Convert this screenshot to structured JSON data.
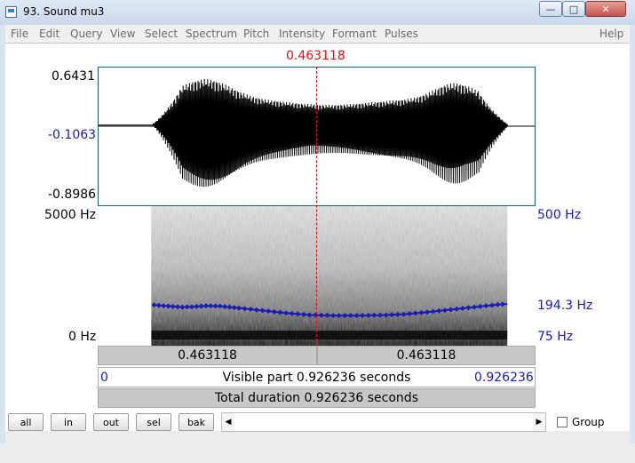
{
  "window": {
    "title": "93. Sound mu3",
    "minimize_glyph": "—",
    "maximize_glyph": "□",
    "close_glyph": "✕",
    "icon": "praat-window-icon"
  },
  "menu": {
    "items": [
      "File",
      "Edit",
      "Query",
      "View",
      "Select",
      "Spectrum",
      "Pitch",
      "Intensity",
      "Formant",
      "Pulses"
    ],
    "help": "Help"
  },
  "cursor": {
    "time_label": "0.463118",
    "time": 0.463118
  },
  "waveform": {
    "max_label": "0.6431",
    "zero_label": "-0.1063",
    "min_label": "-0.8986",
    "max": 0.6431,
    "min": -0.8986,
    "sound_start": 0.114,
    "sound_end": 0.87
  },
  "spectrogram": {
    "max_label": "5000 Hz",
    "min_label": "0 Hz",
    "pitch_top_label": "500 Hz",
    "pitch_value_label": "194.3 Hz",
    "pitch_bottom_label": "75 Hz",
    "pitch_min": 75,
    "pitch_max": 500,
    "pitch_track": [
      [
        0.12,
        200
      ],
      [
        0.15,
        196
      ],
      [
        0.18,
        193
      ],
      [
        0.2,
        194
      ],
      [
        0.23,
        197
      ],
      [
        0.26,
        196
      ],
      [
        0.3,
        190
      ],
      [
        0.35,
        182
      ],
      [
        0.4,
        174
      ],
      [
        0.45,
        168
      ],
      [
        0.5,
        166
      ],
      [
        0.55,
        166
      ],
      [
        0.6,
        167
      ],
      [
        0.65,
        170
      ],
      [
        0.7,
        177
      ],
      [
        0.75,
        185
      ],
      [
        0.8,
        193
      ],
      [
        0.85,
        201
      ],
      [
        0.87,
        203
      ]
    ],
    "pitch_color": "#1a1ab4"
  },
  "bars": {
    "left_segment": "0.463118",
    "right_segment": "0.463118",
    "visible_start": "0",
    "visible_text": "Visible part 0.926236 seconds",
    "visible_end": "0.926236",
    "total_text": "Total duration 0.926236 seconds"
  },
  "buttons": {
    "all": "all",
    "in": "in",
    "out": "out",
    "sel": "sel",
    "bak": "bak"
  },
  "scrollbar": {
    "left_arrow": "◀",
    "right_arrow": "▶"
  },
  "group": {
    "label": "Group",
    "checked": false
  },
  "colors": {
    "accent_blue": "#1a1ab4",
    "cursor_red": "#e01010",
    "frame": "#1a6a6a"
  }
}
